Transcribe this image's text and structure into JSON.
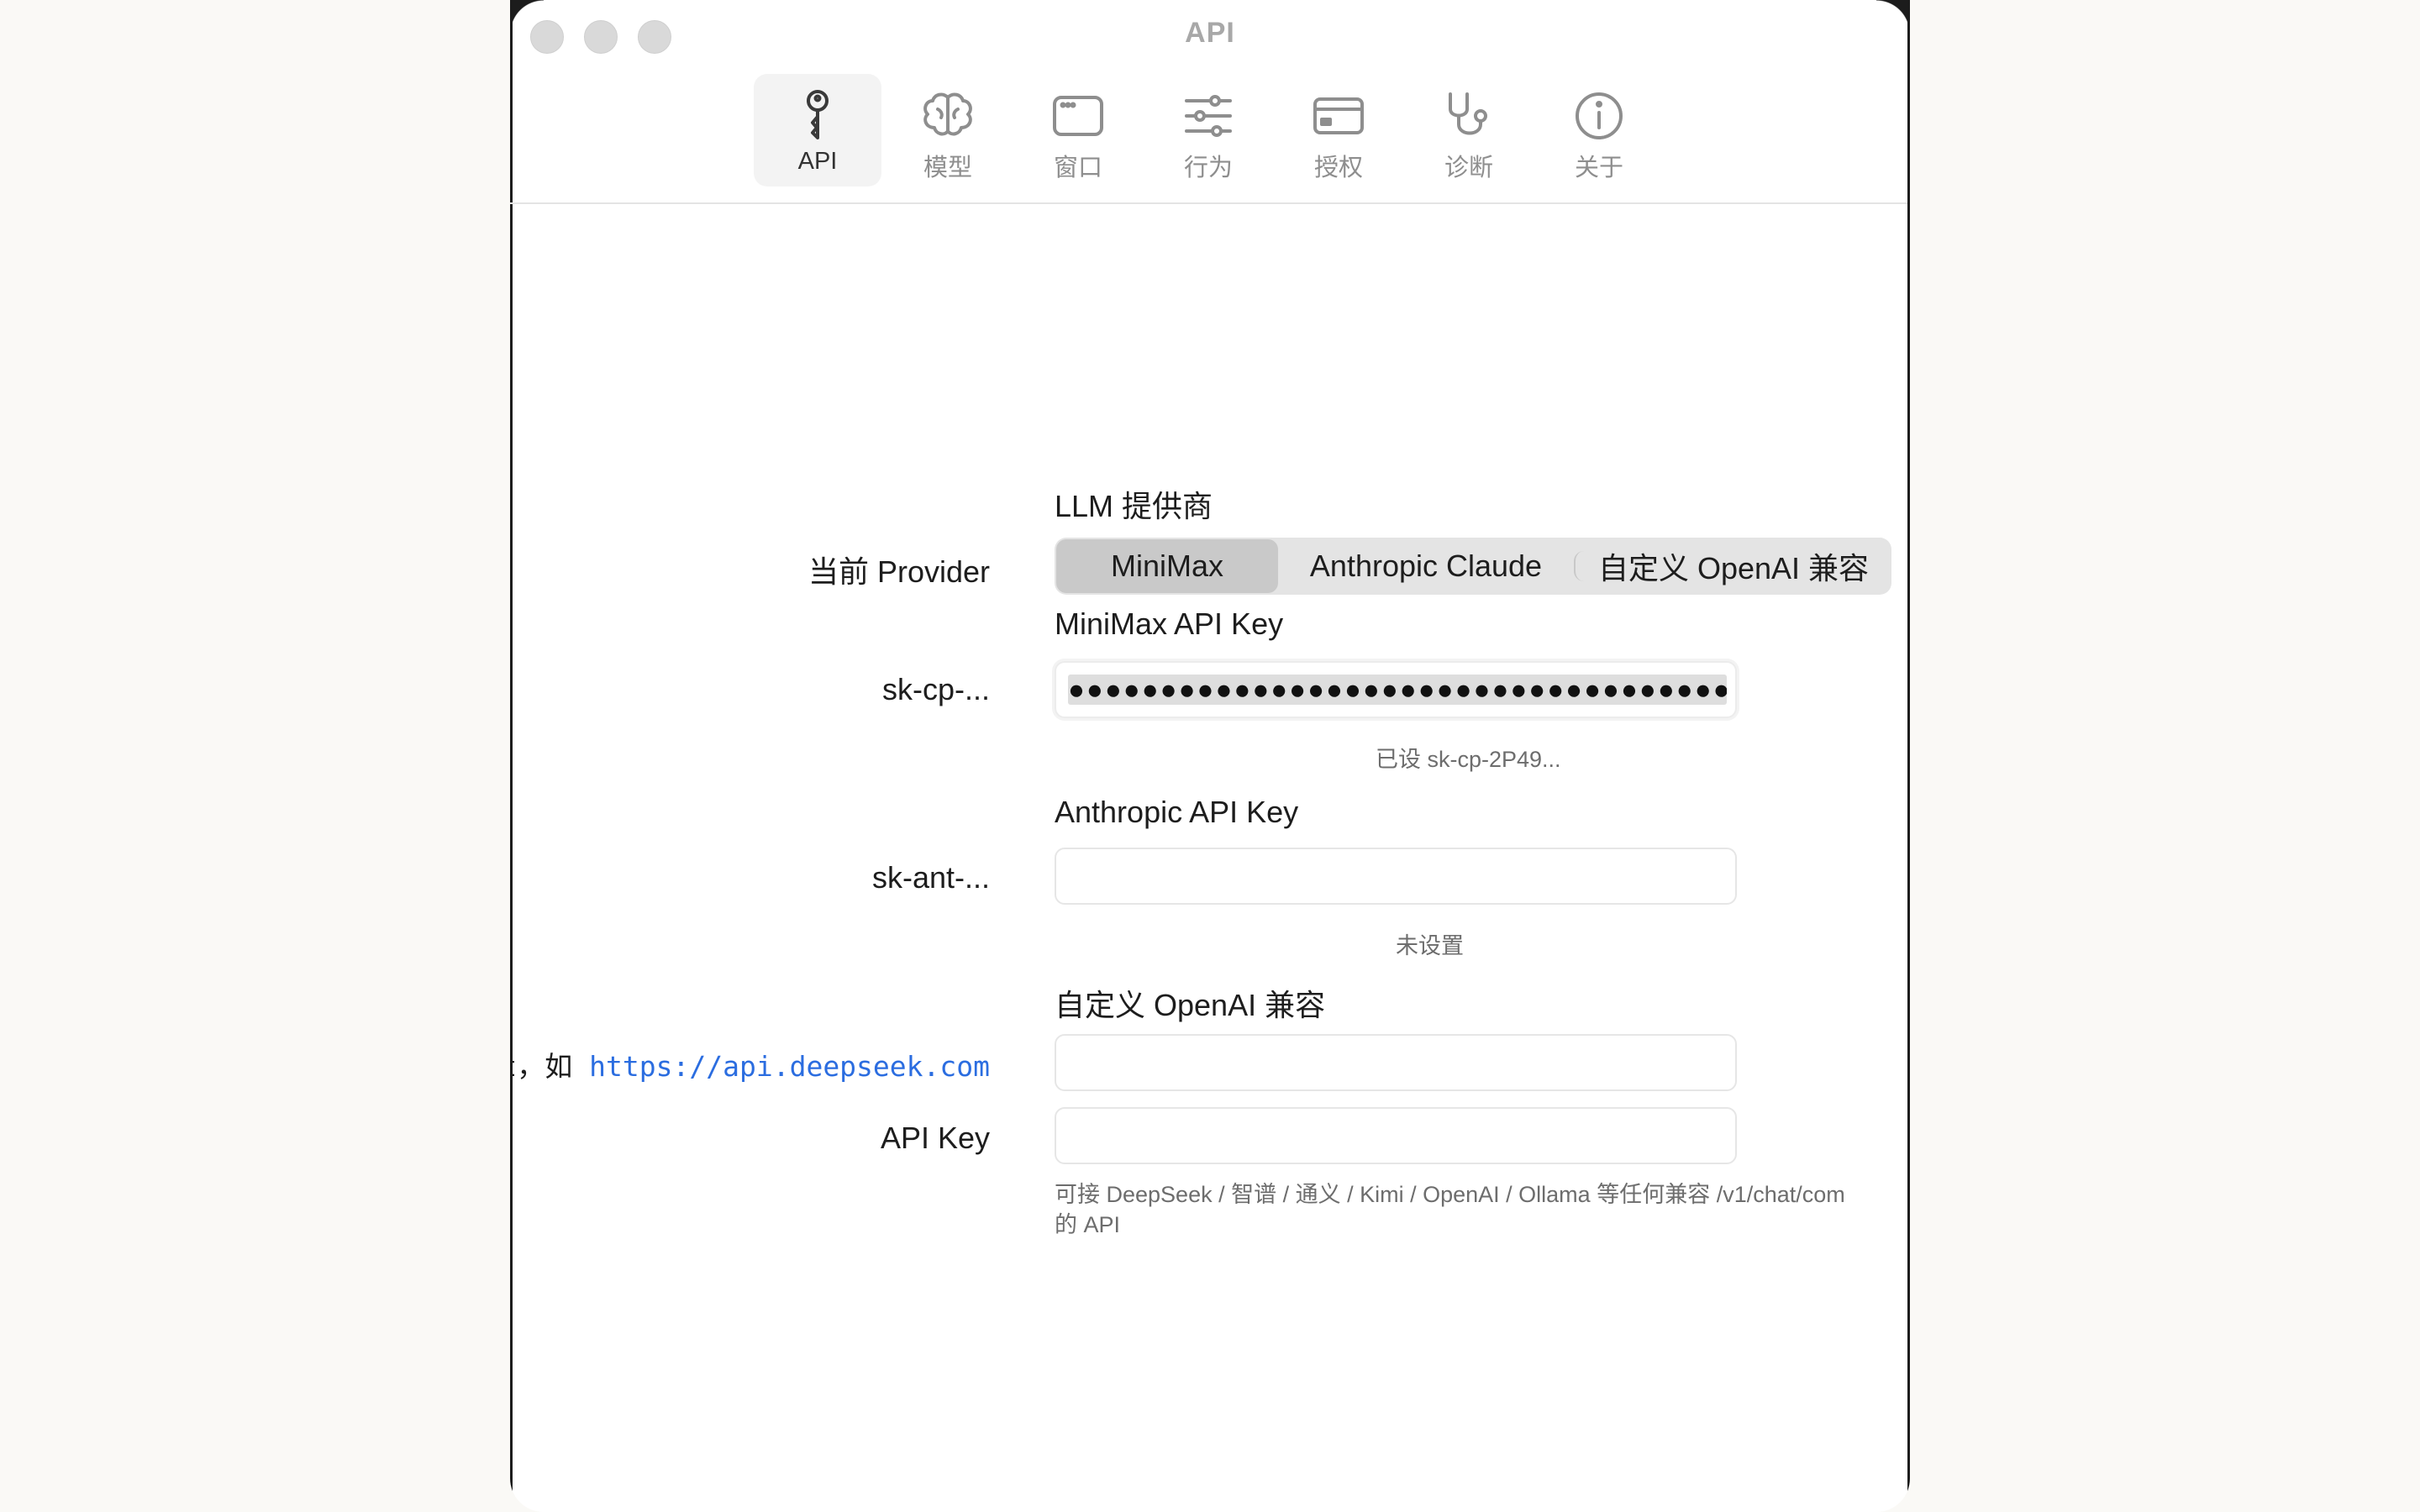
{
  "window": {
    "title": "API"
  },
  "toolbar": {
    "tabs": [
      {
        "label": "API",
        "icon": "key-icon",
        "active": true
      },
      {
        "label": "模型",
        "icon": "brain-icon",
        "active": false
      },
      {
        "label": "窗口",
        "icon": "window-icon",
        "active": false
      },
      {
        "label": "行为",
        "icon": "sliders-icon",
        "active": false
      },
      {
        "label": "授权",
        "icon": "credit-card-icon",
        "active": false
      },
      {
        "label": "诊断",
        "icon": "stethoscope-icon",
        "active": false
      },
      {
        "label": "关于",
        "icon": "info-icon",
        "active": false
      }
    ]
  },
  "provider": {
    "section_title": "LLM 提供商",
    "label": "当前 Provider",
    "options": [
      "MiniMax",
      "Anthropic Claude",
      "自定义 OpenAI 兼容"
    ],
    "selected": "MiniMax"
  },
  "minimax": {
    "section_title": "MiniMax API Key",
    "label": "sk-cp-...",
    "masked_value": "●●●●●●●●●●●●●●●●●●●●●●●●●●●●●●●●●●●●●",
    "status": "已设 sk-cp-2P49..."
  },
  "anthropic": {
    "section_title": "Anthropic API Key",
    "label": "sk-ant-...",
    "value": "",
    "status": "未设置"
  },
  "custom": {
    "section_title": "自定义 OpenAI 兼容",
    "endpoint_label_prefix": "nt，如 ",
    "endpoint_label_url": "https://api.deepseek.com",
    "endpoint_value": "",
    "api_key_label": "API Key",
    "api_key_value": "",
    "hint_line1": "可接 DeepSeek / 智谱 / 通义 / Kimi / OpenAI / Ollama 等任何兼容 /v1/chat/com",
    "hint_line2": "的 API"
  },
  "colors": {
    "accent_link": "#2b6de0",
    "selected_segment": "#c9c9c9"
  }
}
